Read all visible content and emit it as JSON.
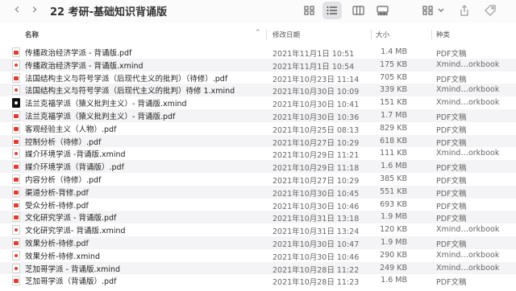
{
  "window": {
    "title": "22 考研-基础知识背诵版",
    "back_icon": "chevron-left",
    "forward_icon": "chevron-right"
  },
  "toolbar": {
    "icons": [
      "grid-view-icon",
      "list-view-icon",
      "column-view-icon",
      "gallery-view-icon",
      "group-icon",
      "share-icon",
      "tag-icon"
    ]
  },
  "header": {
    "name": "名称",
    "date": "修改日期",
    "size": "大小",
    "kind": "种类"
  },
  "files": [
    {
      "name": "传播政治经济学派 - 背诵版.pdf",
      "date": "2021年11月1日 10:51",
      "size": "1.4 MB",
      "kind": "PDF文稿",
      "icon": "pdf"
    },
    {
      "name": "传播政治经济学派 - 背诵版.xmind",
      "date": "2021年11月1日 10:54",
      "size": "175 KB",
      "kind": "Xmind…orkbook",
      "icon": "xmind"
    },
    {
      "name": "法国结构主义与符号学派（后现代主义的批判）（待修）.pdf",
      "date": "2021年10月23日 11:14",
      "size": "705 KB",
      "kind": "PDF文稿",
      "icon": "pdf"
    },
    {
      "name": "法国结构主义与符号学派（后现代主义的批判）待修 1.xmind",
      "date": "2021年10月30日 10:09",
      "size": "339 KB",
      "kind": "Xmind…orkbook",
      "icon": "xmind"
    },
    {
      "name": "法兰克福学派（猿义批判主义）- 背诵版.xmind",
      "date": "2021年10月30日 10:41",
      "size": "151 KB",
      "kind": "Xmind…orkbook",
      "icon": "xmind-dark"
    },
    {
      "name": "法兰克福学派（猿义批判主义）- 背诵版.pdf",
      "date": "2021年10月30日 10:36",
      "size": "1.7 MB",
      "kind": "PDF文稿",
      "icon": "pdf"
    },
    {
      "name": "客观经验主义（人物）.pdf",
      "date": "2021年10月25日 08:13",
      "size": "829 KB",
      "kind": "PDF文稿",
      "icon": "pdf"
    },
    {
      "name": "控制分析（待修）.pdf",
      "date": "2021年10月27日 10:29",
      "size": "618 KB",
      "kind": "PDF文稿",
      "icon": "pdf"
    },
    {
      "name": "媒介环境学派 -背诵版.xmind",
      "date": "2021年10月29日 11:21",
      "size": "111 KB",
      "kind": "Xmind…orkbook",
      "icon": "xmind"
    },
    {
      "name": "媒介环境学派（背诵版）.pdf",
      "date": "2021年10月29日 11:18",
      "size": "1.6 MB",
      "kind": "PDF文稿",
      "icon": "pdf"
    },
    {
      "name": "内容分析（待修）.pdf",
      "date": "2021年10月27日 10:29",
      "size": "385 KB",
      "kind": "PDF文稿",
      "icon": "pdf"
    },
    {
      "name": "渠道分析-背修.pdf",
      "date": "2021年10月30日 10:45",
      "size": "551 KB",
      "kind": "PDF文稿",
      "icon": "pdf"
    },
    {
      "name": "受众分析-待修.pdf",
      "date": "2021年10月30日 10:46",
      "size": "693 KB",
      "kind": "PDF文稿",
      "icon": "pdf"
    },
    {
      "name": "文化研究学派 - 背诵版.pdf",
      "date": "2021年10月31日 13:18",
      "size": "1.9 MB",
      "kind": "PDF文稿",
      "icon": "pdf"
    },
    {
      "name": "文化研究学派- 背诵版.xmind",
      "date": "2021年10月31日 13:24",
      "size": "120 KB",
      "kind": "Xmind…orkbook",
      "icon": "xmind"
    },
    {
      "name": "效果分析-待修.pdf",
      "date": "2021年10月30日 10:47",
      "size": "1.9 MB",
      "kind": "PDF文稿",
      "icon": "pdf"
    },
    {
      "name": "效果分析-待修.xmind",
      "date": "2021年10月30日 10:46",
      "size": "290 KB",
      "kind": "Xmind…orkbook",
      "icon": "xmind"
    },
    {
      "name": "芝加哥学派 - 背诵版.xmind",
      "date": "2021年10月28日 11:22",
      "size": "249 KB",
      "kind": "Xmind…orkbook",
      "icon": "xmind"
    },
    {
      "name": "芝加哥学派（背诵版）.pdf",
      "date": "2021年10月28日 11:23",
      "size": "1.6 MB",
      "kind": "PDF文稿",
      "icon": "pdf"
    }
  ]
}
